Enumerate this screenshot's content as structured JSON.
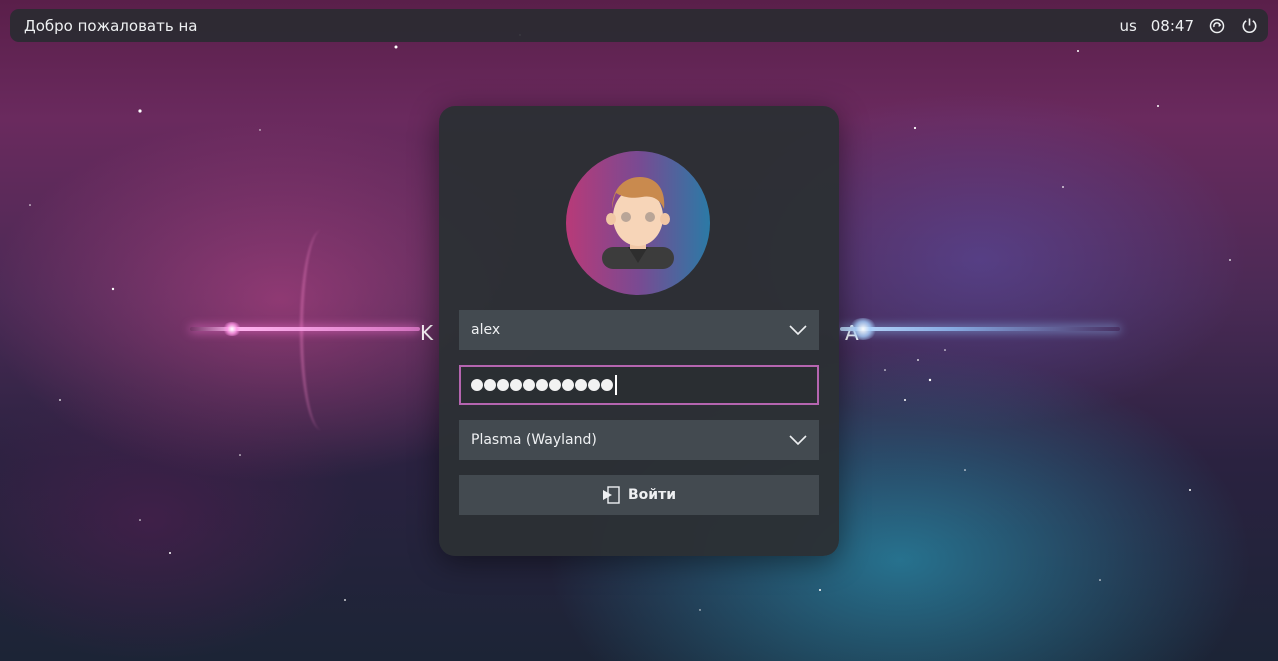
{
  "topbar": {
    "welcome_text": "Добро пожаловать на",
    "keyboard_layout": "us",
    "time": "08:47"
  },
  "login": {
    "username": "alex",
    "password_length": 11,
    "session": "Plasma (Wayland)",
    "login_button_label": "Войти"
  },
  "background_glyphs": {
    "left": "K",
    "right": "A"
  },
  "colors": {
    "password_border": "#b565b0",
    "field_bg": "#434a50",
    "card_bg": "#2c3034"
  },
  "icons": {
    "user_dropdown": "chevron-down-icon",
    "session_dropdown": "chevron-down-icon",
    "login": "login-arrow-icon",
    "switch_user": "switch-icon",
    "power": "power-icon",
    "avatar": "user-avatar"
  }
}
